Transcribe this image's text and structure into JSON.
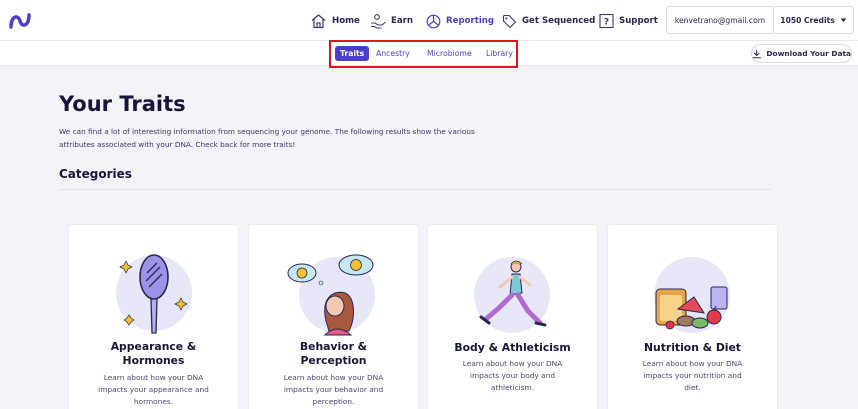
{
  "app": {
    "logo_icon": "nebula-logo-icon",
    "accent": "#4b3fc9",
    "highlight": "#e4141b"
  },
  "nav": {
    "items": [
      {
        "label": "Home",
        "icon": "home-icon"
      },
      {
        "label": "Earn",
        "icon": "hand-coins-icon"
      },
      {
        "label": "Reporting",
        "icon": "pie-chart-icon"
      },
      {
        "label": "Get Sequenced",
        "icon": "tag-icon"
      },
      {
        "label": "Support",
        "icon": "question-icon"
      }
    ],
    "active": "Reporting"
  },
  "account": {
    "email": "kenvetrano@gmail.com",
    "credits": "1050 Credits"
  },
  "subnav": {
    "tabs": [
      "Traits",
      "Ancestry",
      "Microbiome",
      "Library"
    ],
    "active": "Traits",
    "download_label": "Download Your Data"
  },
  "main": {
    "title": "Your Traits",
    "intro": "We can find a lot of interesting information from sequencing your genome. The following results show the various attributes associated with your DNA. Check back for more traits!",
    "section_title": "Categories"
  },
  "cards": [
    {
      "title_line1": "Appearance &",
      "title_line2": "Hormones",
      "desc_line1": "Learn about how your DNA",
      "desc_line2": "impacts your appearance and",
      "desc_line3": "hormones.",
      "icon": "mirror-illustration"
    },
    {
      "title_line1": "Behavior &",
      "title_line2": "Perception",
      "desc_line1": "Learn about how your DNA",
      "desc_line2": "impacts your behavior and",
      "desc_line3": "perception.",
      "icon": "thinking-girl-illustration"
    },
    {
      "title_line1": "Body & Athleticism",
      "desc_line1": "Learn about how your DNA",
      "desc_line2": "impacts your body and",
      "desc_line3": "athleticism.",
      "icon": "runner-illustration"
    },
    {
      "title_line1": "Nutrition & Diet",
      "desc_line1": "Learn about how your DNA",
      "desc_line2": "impacts your nutrition and",
      "desc_line3": "diet.",
      "icon": "food-illustration"
    }
  ]
}
